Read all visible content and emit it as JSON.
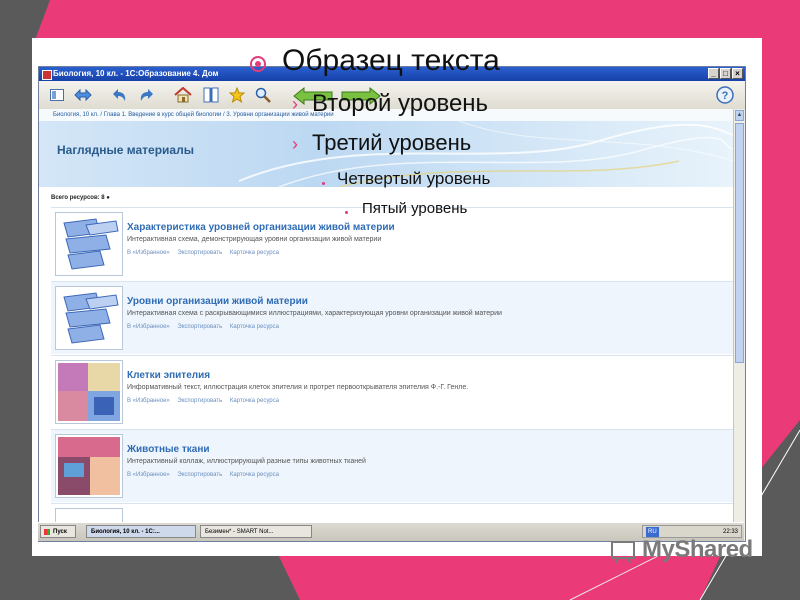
{
  "slide": {
    "level1": "Образец текста",
    "level2": "Второй уровень",
    "level3": "Третий уровень",
    "level4": "Четвертый уровень",
    "level5": "Пятый уровень",
    "colors": {
      "accent": "#e23c7c",
      "frame_dark": "#5a5a5a"
    }
  },
  "window": {
    "title": "Биология, 10 кл. - 1С:Образование 4. Дом",
    "breadcrumb": "Биология, 10 кл. / Глава 1. Введение в курс общей биологии / 3. Уровни организации живой материи",
    "section_title": "Наглядные материалы",
    "total_label": "Всего ресурсов: 8",
    "toolbar_icons": [
      "layout-icon",
      "arrows-icon",
      "undo-icon",
      "redo-icon",
      "home-icon",
      "book-icon",
      "star-icon",
      "search-icon",
      "help-icon"
    ]
  },
  "resources": [
    {
      "title": "Характеристика уровней организации живой материи",
      "desc": "Интерактивная схема, демонстрирующая уровни организации живой материи",
      "links": [
        "В «Избранное»",
        "Экспортировать",
        "Карточка ресурса"
      ]
    },
    {
      "title": "Уровни организации живой материи",
      "desc": "Интерактивная схема с раскрывающимися иллюстрациями, характеризующая уровни организации живой материи",
      "links": [
        "В «Избранное»",
        "Экспортировать",
        "Карточка ресурса"
      ]
    },
    {
      "title": "Клетки эпителия",
      "desc": "Информативный текст, иллюстрация клеток эпителия и протрет первооткрывателя эпителия Ф.-Г. Генле.",
      "links": [
        "В «Избранное»",
        "Экспортировать",
        "Карточка ресурса"
      ]
    },
    {
      "title": "Животные ткани",
      "desc": "Интерактивный коллаж, иллюстрирующий разные типы животных тканей",
      "links": [
        "В «Избранное»",
        "Экспортировать",
        "Карточка ресурса"
      ]
    }
  ],
  "taskbar": {
    "start": "Пуск",
    "task1": "Биология, 10 кл. - 1С:...",
    "task2": "Безимен* - SMART Not...",
    "lang": "RU",
    "clock": "22:33"
  },
  "watermark": "MyShared"
}
